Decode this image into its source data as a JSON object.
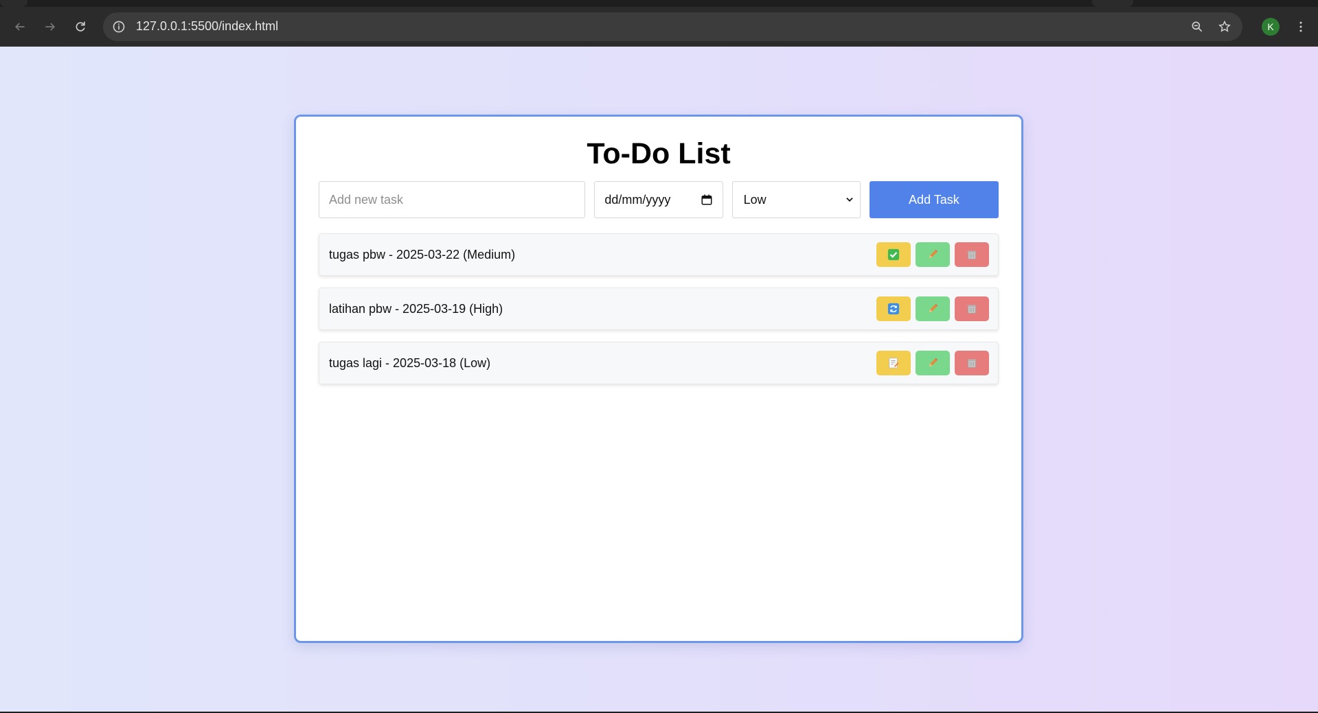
{
  "browser": {
    "url": "127.0.0.1:5500/index.html",
    "profile_initial": "K"
  },
  "app": {
    "title": "To-Do List",
    "form": {
      "task_placeholder": "Add new task",
      "task_value": "",
      "date_placeholder": "dd/mm/yyyy",
      "priority_selected": "Low",
      "priority_options": [
        "Low",
        "Medium",
        "High"
      ],
      "add_label": "Add Task"
    },
    "tasks": [
      {
        "text": "tugas pbw - 2025-03-22 (Medium)",
        "status_icon": "checkmark-icon"
      },
      {
        "text": "latihan pbw - 2025-03-19 (High)",
        "status_icon": "refresh-icon"
      },
      {
        "text": "tugas lagi - 2025-03-18 (Low)",
        "status_icon": "memo-icon"
      }
    ]
  },
  "colors": {
    "card_border": "#6a97ea",
    "add_button": "#5082ea",
    "toggle_button": "#f2cd4e",
    "edit_button": "#79d88b",
    "delete_button": "#e67c7c"
  }
}
